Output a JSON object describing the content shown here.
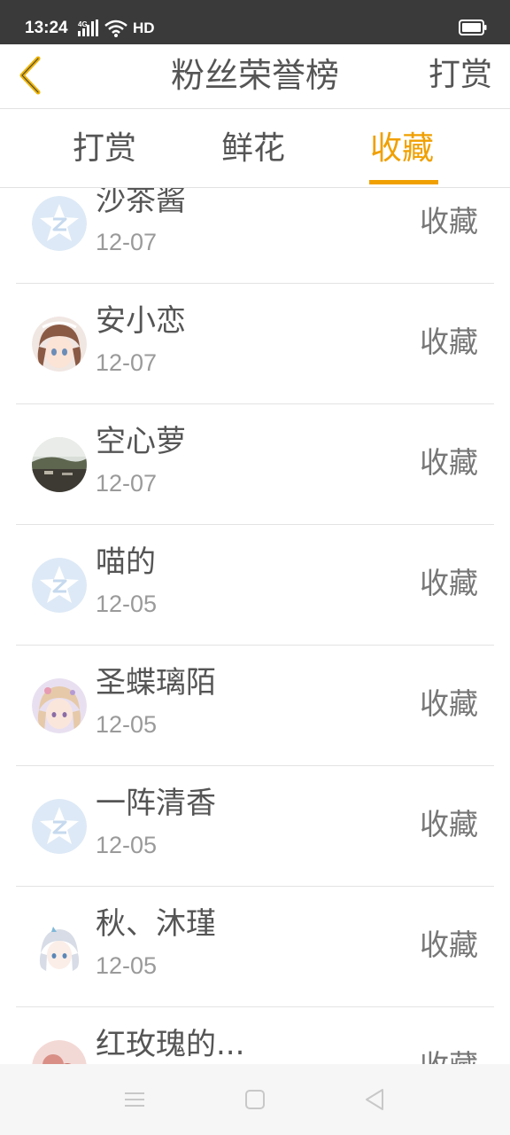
{
  "status_bar": {
    "time": "13:24",
    "network": "4G",
    "hd": "HD"
  },
  "header": {
    "title": "粉丝荣誉榜",
    "action_label": "打赏"
  },
  "tabs": [
    {
      "label": "打赏",
      "active": false
    },
    {
      "label": "鲜花",
      "active": false
    },
    {
      "label": "收藏",
      "active": true
    }
  ],
  "colors": {
    "accent": "#f0a000",
    "text": "#555555",
    "subtext": "#9a9a9a",
    "divider": "#e3e3e3"
  },
  "fans": [
    {
      "name": "沙茶酱",
      "date": "12-07",
      "action": "收藏",
      "avatar": "default-qq-avatar-icon"
    },
    {
      "name": "安小恋",
      "date": "12-07",
      "action": "收藏",
      "avatar": "anime-girl-avatar"
    },
    {
      "name": "空心萝",
      "date": "12-07",
      "action": "收藏",
      "avatar": "landscape-photo-avatar"
    },
    {
      "name": "喵的",
      "date": "12-05",
      "action": "收藏",
      "avatar": "default-qq-avatar-icon"
    },
    {
      "name": "圣蝶璃陌",
      "date": "12-05",
      "action": "收藏",
      "avatar": "anime-girl-avatar"
    },
    {
      "name": "一阵清香",
      "date": "12-05",
      "action": "收藏",
      "avatar": "default-qq-avatar-icon"
    },
    {
      "name": "秋、沐瑾",
      "date": "12-05",
      "action": "收藏",
      "avatar": "anime-girl-avatar"
    },
    {
      "name": "红玫瑰的...",
      "date": "",
      "action": "收藏",
      "avatar": "pink-photo-avatar"
    }
  ]
}
